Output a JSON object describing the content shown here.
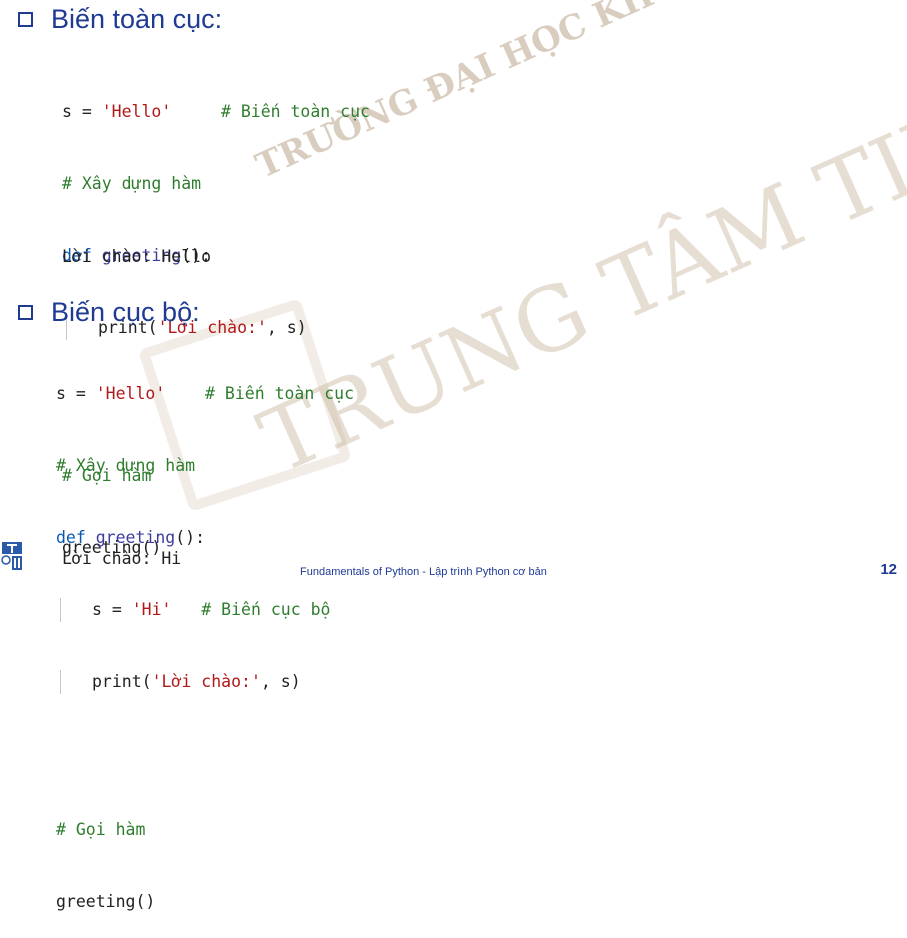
{
  "watermark": {
    "line1": "TRƯỜNG ĐẠI HỌC KHOA HỌC TỰ NHIÊN",
    "line2": "TRUNG TÂM TIN HỌC"
  },
  "section1": {
    "title": "Biến toàn cục:",
    "code": {
      "l1_var": "s = ",
      "l1_str": "'Hello'",
      "l1_cm": "     # Biến toàn cục",
      "l2_cm": "# Xây dựng hàm",
      "l3_kw": "def",
      "l3_fn": " greeting",
      "l3_rest": "():",
      "l4_fn": "print",
      "l4_open": "(",
      "l4_str": "'Lời chào:'",
      "l4_rest": ", s)",
      "l6_cm": "# Gọi hàm",
      "l7": "greeting()"
    },
    "output": "Lời chào: Hello"
  },
  "section2": {
    "title": "Biến cục bộ:",
    "code": {
      "l1_var": "s = ",
      "l1_str": "'Hello'",
      "l1_cm": "    # Biến toàn cục",
      "l2_cm": "# Xây dựng hàm",
      "l3_kw": "def",
      "l3_fn": " greeting",
      "l3_rest": "():",
      "l4_var": "s = ",
      "l4_str": "'Hi'",
      "l4_cm": "   # Biến cục bộ",
      "l5_fn": "print",
      "l5_open": "(",
      "l5_str": "'Lời chào:'",
      "l5_rest": ", s)",
      "l7_cm": "# Gọi hàm",
      "l8": "greeting()"
    },
    "output": "Lời chào: Hi"
  },
  "footer": {
    "text": "Fundamentals of Python - Lập trình Python cơ bản",
    "page": "12"
  }
}
